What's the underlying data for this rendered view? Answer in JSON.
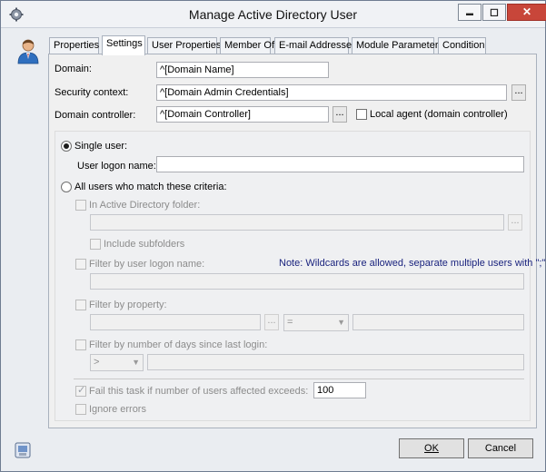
{
  "window": {
    "title": "Manage Active Directory User"
  },
  "caption_buttons": {
    "minimize": "▬",
    "maximize": "◻",
    "close": "✕"
  },
  "tabs": [
    {
      "label": "Properties"
    },
    {
      "label": "Settings",
      "active": true
    },
    {
      "label": "User Properties"
    },
    {
      "label": "Member Of"
    },
    {
      "label": "E-mail Addresses"
    },
    {
      "label": "Module Parameters"
    },
    {
      "label": "Condition"
    }
  ],
  "settings": {
    "domain_label": "Domain:",
    "domain_value": "^[Domain Name]",
    "security_label": "Security context:",
    "security_value": "^[Domain Admin Credentials]",
    "dc_label": "Domain controller:",
    "dc_value": "^[Domain Controller]",
    "browse_label": "...",
    "local_agent_label": "Local agent (domain controller)",
    "single_user_label": "Single user:",
    "logon_name_label": "User logon name:",
    "logon_name_value": "",
    "all_users_label": "All users who match these criteria:",
    "ad_folder_label": "In Active Directory folder:",
    "ad_folder_value": "",
    "include_subfolders_label": "Include subfolders",
    "filter_logon_label": "Filter by user logon name:",
    "filter_logon_note": "Note: Wildcards are allowed, separate multiple users with \";\".",
    "filter_logon_value": "",
    "filter_property_label": "Filter by property:",
    "filter_property_value": "",
    "operator_value": "=",
    "filter_property_match": "",
    "filter_days_label": "Filter by number of days since last login:",
    "days_operator_value": ">",
    "days_value": "",
    "fail_task_label": "Fail this task if number of users affected exceeds:",
    "fail_task_value": "100",
    "ignore_errors_label": "Ignore errors"
  },
  "buttons": {
    "ok": "OK",
    "cancel": "Cancel"
  },
  "icons": {
    "app": "gear-icon",
    "user": "user-avatar-icon",
    "help": "help-icon"
  },
  "colors": {
    "note": "#1a237e",
    "close": "#c8463a"
  }
}
